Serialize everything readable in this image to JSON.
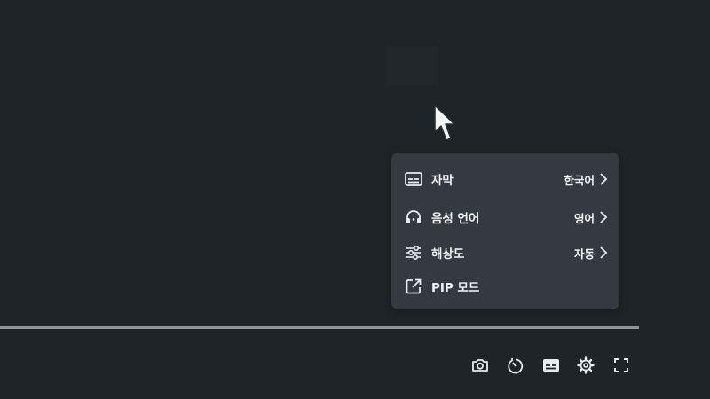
{
  "player": {
    "settings_menu": {
      "items": [
        {
          "icon": "subtitles-icon",
          "label": "자막",
          "value": "한국어"
        },
        {
          "icon": "headset-icon",
          "label": "음성 언어",
          "value": "영어"
        },
        {
          "icon": "sliders-icon",
          "label": "해상도",
          "value": "자동"
        },
        {
          "icon": "external-link-icon",
          "label": "PIP 모드",
          "value": ""
        }
      ]
    },
    "progress": {
      "fraction": 0.9
    },
    "controls": [
      "camera-icon",
      "timer-icon",
      "subtitles-icon",
      "settings-gear-icon",
      "fullscreen-icon"
    ]
  }
}
